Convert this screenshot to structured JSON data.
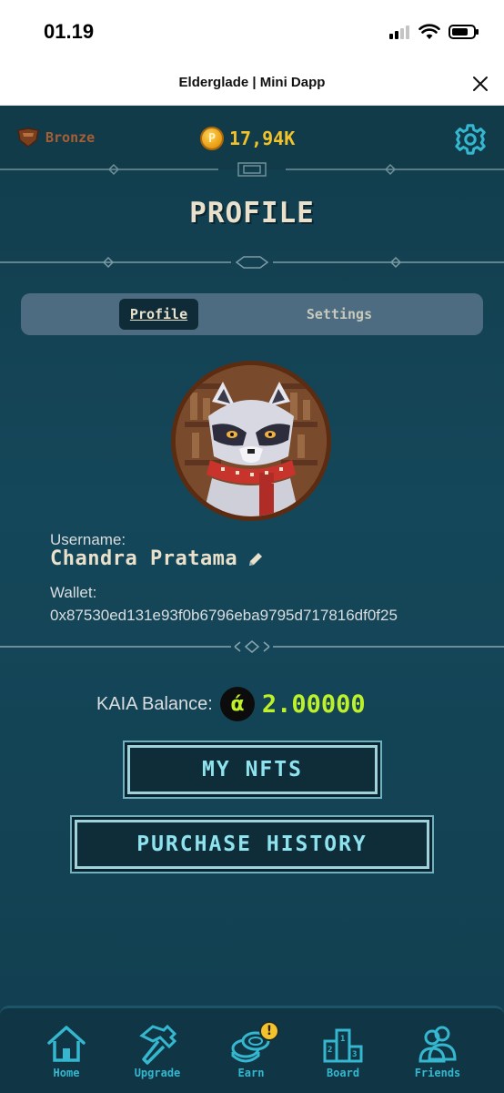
{
  "status_bar": {
    "time": "01.19"
  },
  "app": {
    "title": "Elderglade | Mini Dapp"
  },
  "header": {
    "rank": "Bronze",
    "coin_amount": "17,94K",
    "coin_symbol": "P"
  },
  "page": {
    "title": "PROFILE"
  },
  "tabs": [
    {
      "label": "Profile",
      "active": true
    },
    {
      "label": "Settings",
      "active": false
    }
  ],
  "profile": {
    "username_label": "Username:",
    "username": "Chandra Pratama",
    "wallet_label": "Wallet:",
    "wallet_address": "0x87530ed131e93f0b6796eba9795d717816df0f25"
  },
  "balance": {
    "label": "KAIA Balance:",
    "value": "2.00000",
    "token_glyph": "ά"
  },
  "buttons": {
    "my_nfts": "MY NFTS",
    "purchase_history": "PURCHASE HISTORY"
  },
  "nav": [
    {
      "label": "Home",
      "icon": "home-icon"
    },
    {
      "label": "Upgrade",
      "icon": "hammer-icon"
    },
    {
      "label": "Earn",
      "icon": "coins-icon",
      "badge": "!"
    },
    {
      "label": "Board",
      "icon": "podium-icon"
    },
    {
      "label": "Friends",
      "icon": "friends-icon"
    }
  ],
  "colors": {
    "background": "#14475a",
    "accent_cyan": "#35b7cf",
    "balance_green": "#bff12a",
    "gold": "#f2c22b",
    "title_cream": "#e9e1cb"
  }
}
